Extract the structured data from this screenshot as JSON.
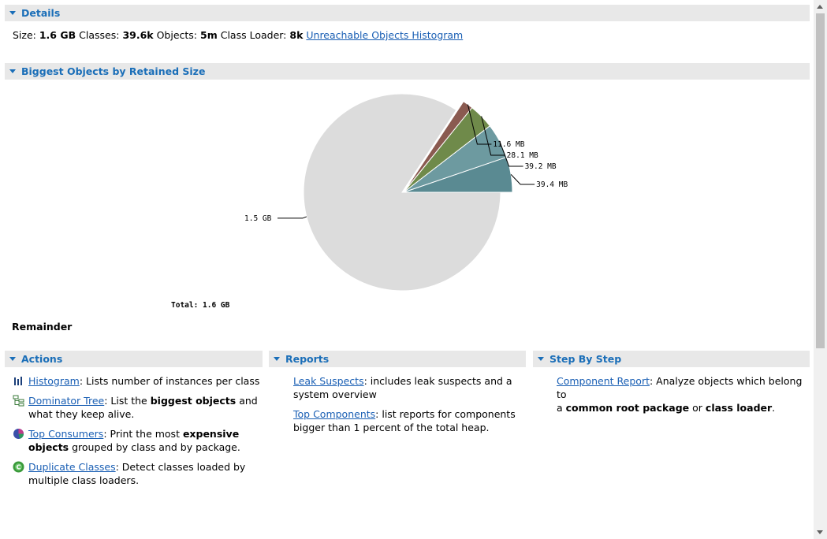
{
  "details": {
    "header": "Details",
    "size_label": "Size:",
    "size_value": "1.6 GB",
    "classes_label": "Classes:",
    "classes_value": "39.6k",
    "objects_label": "Objects:",
    "objects_value": "5m",
    "classloader_label": "Class Loader:",
    "classloader_value": "8k",
    "histogram_link": "Unreachable Objects Histogram"
  },
  "biggest": {
    "header": "Biggest Objects by Retained Size",
    "total_label": "Total: 1.6 GB",
    "remainder_label": "Remainder"
  },
  "chart_data": {
    "type": "pie",
    "title": "",
    "slices": [
      {
        "label": "39.4 MB",
        "value": 39.4,
        "color": "#5a8a92"
      },
      {
        "label": "39.2 MB",
        "value": 39.2,
        "color": "#6d9aa0"
      },
      {
        "label": "28.1 MB",
        "value": 28.1,
        "color": "#6f8a4a"
      },
      {
        "label": "11.6 MB",
        "value": 11.6,
        "color": "#8a5a50"
      },
      {
        "label": "1.5 GB",
        "value": 1536,
        "color": "#dcdcdc"
      }
    ]
  },
  "actions": {
    "header": "Actions",
    "histogram": {
      "link": "Histogram",
      "text": ": Lists number of instances per class"
    },
    "dominator": {
      "link": "Dominator Tree",
      "text1": ": List the ",
      "bold": "biggest objects",
      "text2": " and",
      "text3": "what they keep alive."
    },
    "consumers": {
      "link": "Top Consumers",
      "text1": ": Print the most ",
      "bold1": "expensive",
      "bold2": "objects",
      "text2": " grouped by class and by package."
    },
    "duplicates": {
      "link": "Duplicate Classes",
      "text1": ": Detect classes loaded by",
      "text2": "multiple class loaders."
    }
  },
  "reports": {
    "header": "Reports",
    "leak": {
      "link": "Leak Suspects",
      "text1": ": includes leak suspects and a",
      "text2": "system overview"
    },
    "components": {
      "link": "Top Components",
      "text1": ": list reports for components",
      "text2": "bigger than 1 percent of the total heap."
    }
  },
  "stepbystep": {
    "header": "Step By Step",
    "component": {
      "link": "Component Report",
      "text1": ": Analyze objects which belong to",
      "text2": "a ",
      "bold1": "common root package",
      "text3": " or ",
      "bold2": "class loader",
      "text4": "."
    }
  },
  "colors": {
    "accent": "#1a6eb8",
    "header_bg": "#e8e8e8"
  }
}
